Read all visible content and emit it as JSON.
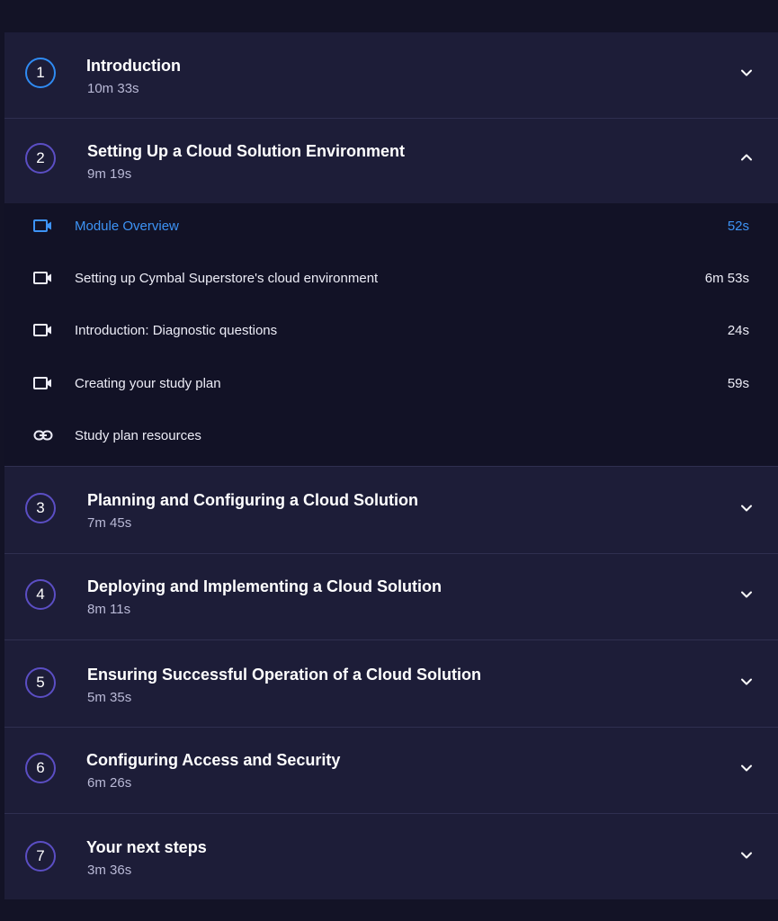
{
  "modules": [
    {
      "number": "1",
      "title": "Introduction",
      "duration": "10m 33s"
    },
    {
      "number": "2",
      "title": "Setting Up a Cloud Solution Environment",
      "duration": "9m 19s"
    },
    {
      "number": "3",
      "title": "Planning and Configuring a Cloud Solution",
      "duration": "7m 45s"
    },
    {
      "number": "4",
      "title": "Deploying and Implementing a Cloud Solution",
      "duration": "8m 11s"
    },
    {
      "number": "5",
      "title": "Ensuring Successful Operation of a Cloud Solution",
      "duration": "5m 35s"
    },
    {
      "number": "6",
      "title": "Configuring Access and Security",
      "duration": "6m 26s"
    },
    {
      "number": "7",
      "title": "Your next steps",
      "duration": "3m 36s"
    }
  ],
  "lessons": [
    {
      "title": "Module Overview",
      "duration": "52s",
      "icon": "video-icon"
    },
    {
      "title": "Setting up Cymbal Superstore's cloud environment",
      "duration": "6m 53s",
      "icon": "video-icon"
    },
    {
      "title": "Introduction: Diagnostic questions",
      "duration": "24s",
      "icon": "video-icon"
    },
    {
      "title": "Creating your study plan",
      "duration": "59s",
      "icon": "video-icon"
    },
    {
      "title": "Study plan resources",
      "duration": "",
      "icon": "link-icon"
    }
  ],
  "colors": {
    "accent": "#3d93f5",
    "circle_border": "#5b4ec4",
    "panel_bg": "#1d1d38",
    "lessons_bg": "#121226"
  }
}
